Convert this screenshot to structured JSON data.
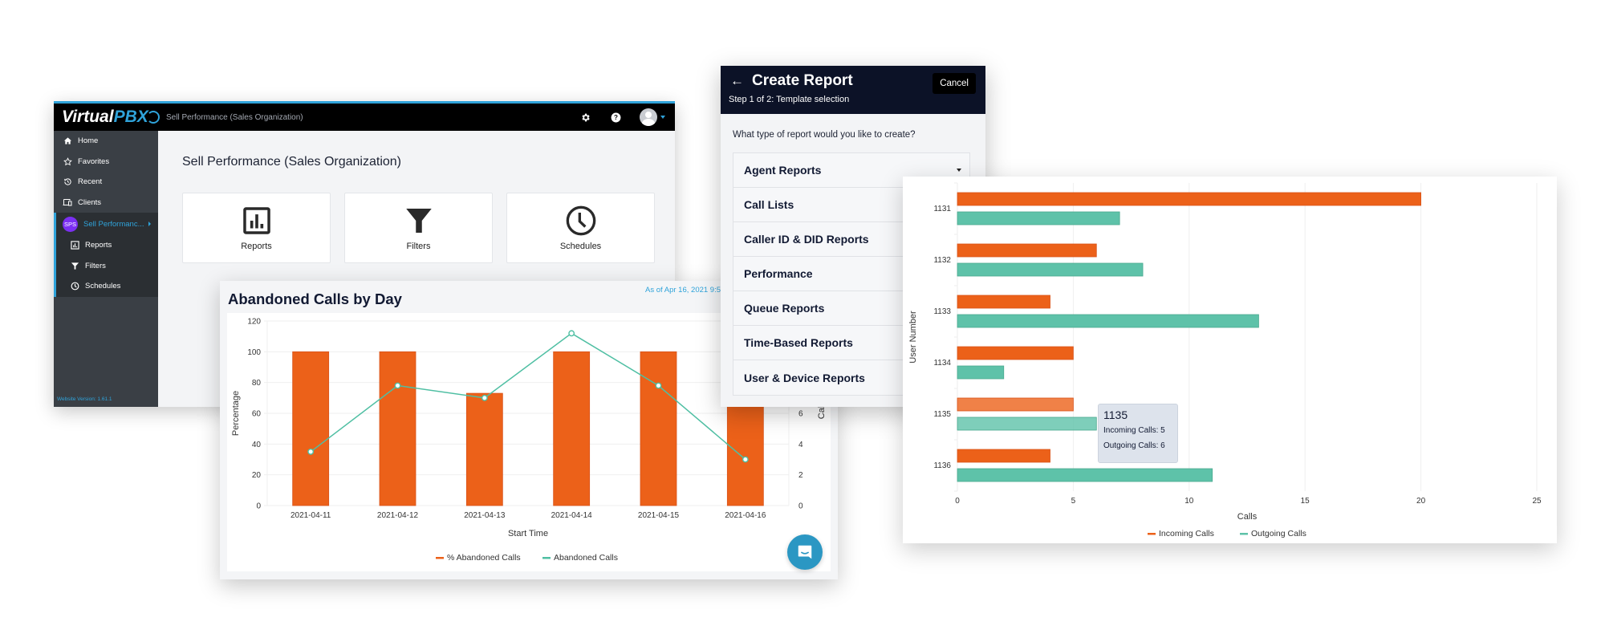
{
  "app": {
    "logo_text_a": "Virtual",
    "logo_text_b": "PBX",
    "topbar_title": "Sell Performance (Sales Organization)",
    "accent_color": "#2fa3da",
    "topbar_icons": [
      "gear-icon",
      "help-icon",
      "avatar"
    ],
    "sidebar": {
      "items": [
        {
          "label": "Home",
          "icon": "home-icon"
        },
        {
          "label": "Favorites",
          "icon": "star-icon"
        },
        {
          "label": "Recent",
          "icon": "history-icon"
        },
        {
          "label": "Clients",
          "icon": "devices-icon"
        }
      ],
      "group": {
        "badge": "SPS",
        "badge_color": "#7b2ff2",
        "label": "Sell Performanc...",
        "children": [
          {
            "label": "Reports",
            "icon": "reports-icon"
          },
          {
            "label": "Filters",
            "icon": "filter-icon"
          },
          {
            "label": "Schedules",
            "icon": "clock-icon"
          }
        ]
      },
      "version": "Website Version: 1.61.1"
    },
    "content": {
      "title": "Sell Performance (Sales Organization)",
      "tiles": [
        {
          "label": "Reports",
          "icon": "reports-icon"
        },
        {
          "label": "Filters",
          "icon": "filter-icon"
        },
        {
          "label": "Schedules",
          "icon": "clock-icon"
        }
      ]
    }
  },
  "abandoned": {
    "title": "Abandoned Calls by Day",
    "as_of": "As of Apr 16, 2021 9:5"
  },
  "dialog": {
    "back_icon": "arrow-left-icon",
    "title": "Create Report",
    "step": "Step 1 of 2: Template selection",
    "cancel_label": "Cancel",
    "question": "What type of report would you like to create?",
    "items": [
      "Agent Reports",
      "Call Lists",
      "Caller ID & DID Reports",
      "Performance",
      "Queue Reports",
      "Time-Based Reports",
      "User & Device Reports"
    ]
  },
  "tooltip": {
    "title": "1135",
    "incoming": "Incoming Calls: 5",
    "outgoing": "Outgoing Calls: 6"
  },
  "chart_data": [
    {
      "type": "bar",
      "title": "Abandoned Calls by Day",
      "categories": [
        "2021-04-11",
        "2021-04-12",
        "2021-04-13",
        "2021-04-14",
        "2021-04-15",
        "2021-04-16"
      ],
      "series": [
        {
          "name": "% Abandoned Calls",
          "kind": "bar",
          "axis": "left",
          "color": "#ec6119",
          "values": [
            100,
            100,
            73,
            100,
            100,
            100
          ]
        },
        {
          "name": "Abandoned Calls",
          "kind": "line",
          "axis": "right",
          "color": "#4fbfa3",
          "values": [
            3.5,
            7.8,
            7,
            11.2,
            7.8,
            3
          ]
        }
      ],
      "xlabel": "Start Time",
      "ylabel": "Percentage",
      "y2label": "Calls",
      "ylim": [
        0,
        120
      ],
      "yticks": [
        0,
        20,
        40,
        60,
        80,
        100,
        120
      ],
      "y2lim": [
        0,
        12
      ],
      "y2ticks": [
        0,
        2,
        4,
        6
      ],
      "grid": true,
      "legend": "bottom"
    },
    {
      "type": "bar",
      "orientation": "horizontal",
      "categories": [
        "1131",
        "1132",
        "1133",
        "1134",
        "1135",
        "1136"
      ],
      "series": [
        {
          "name": "Incoming Calls",
          "color": "#ec6119",
          "values": [
            20,
            6,
            4,
            5,
            5,
            4
          ]
        },
        {
          "name": "Outgoing Calls",
          "color": "#5ec2a9",
          "values": [
            7,
            8,
            13,
            2,
            6,
            11
          ]
        }
      ],
      "highlighted_category": "1135",
      "xlabel": "Calls",
      "ylabel": "User Number",
      "xlim": [
        0,
        25
      ],
      "xticks": [
        0,
        5,
        10,
        15,
        20,
        25
      ],
      "grid": true,
      "legend": "bottom"
    }
  ]
}
